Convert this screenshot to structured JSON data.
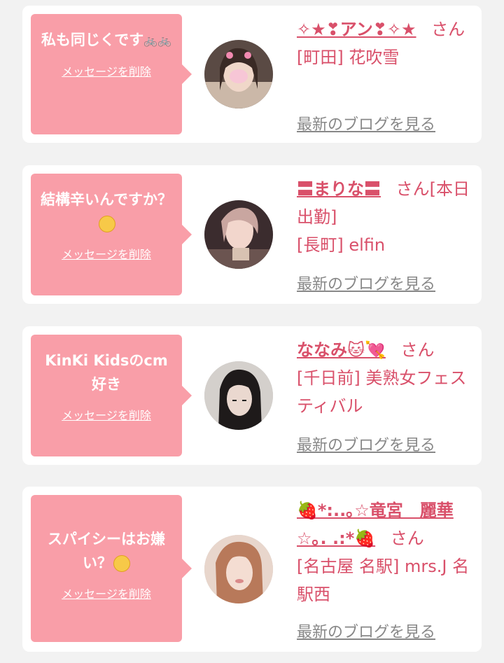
{
  "messages": [
    {
      "bubble_text": "私も同じくです",
      "bubble_emoji": "🚲🚲",
      "delete_label": "メッセージを削除",
      "name": "✧★❣アン❣✧★",
      "honorific": "さん",
      "area_shop": "[町田] 花吹雪",
      "blog_label": "最新のブログを見る"
    },
    {
      "bubble_text": "結構辛いんですか？",
      "bubble_emoji": "🥹",
      "delete_label": "メッセージを削除",
      "name": "〓まりな〓",
      "honorific": "さん[本日出勤]",
      "area_shop": "[長町] elfin",
      "blog_label": "最新のブログを見る"
    },
    {
      "bubble_text": "KinKi Kidsのcm好き",
      "bubble_emoji": "",
      "delete_label": "メッセージを削除",
      "name": "ななみ🐱💘",
      "honorific": "さん",
      "area_shop": "[千日前] 美熟女フェスティバル",
      "blog_label": "最新のブログを見る"
    },
    {
      "bubble_text": "スパイシーはお嫌い？",
      "bubble_emoji": "☺",
      "delete_label": "メッセージを削除",
      "name": "🍓*:..｡☆竜宮　麗華☆｡. .:*🍓",
      "honorific": "さん",
      "area_shop": "[名古屋 名駅] mrs.J 名駅西",
      "blog_label": "最新のブログを見る"
    }
  ],
  "colors": {
    "background": "#f2f2f2",
    "card": "#ffffff",
    "bubble": "#f99ea8",
    "accent_pink": "#d9506a",
    "blog_gray": "#888888"
  }
}
